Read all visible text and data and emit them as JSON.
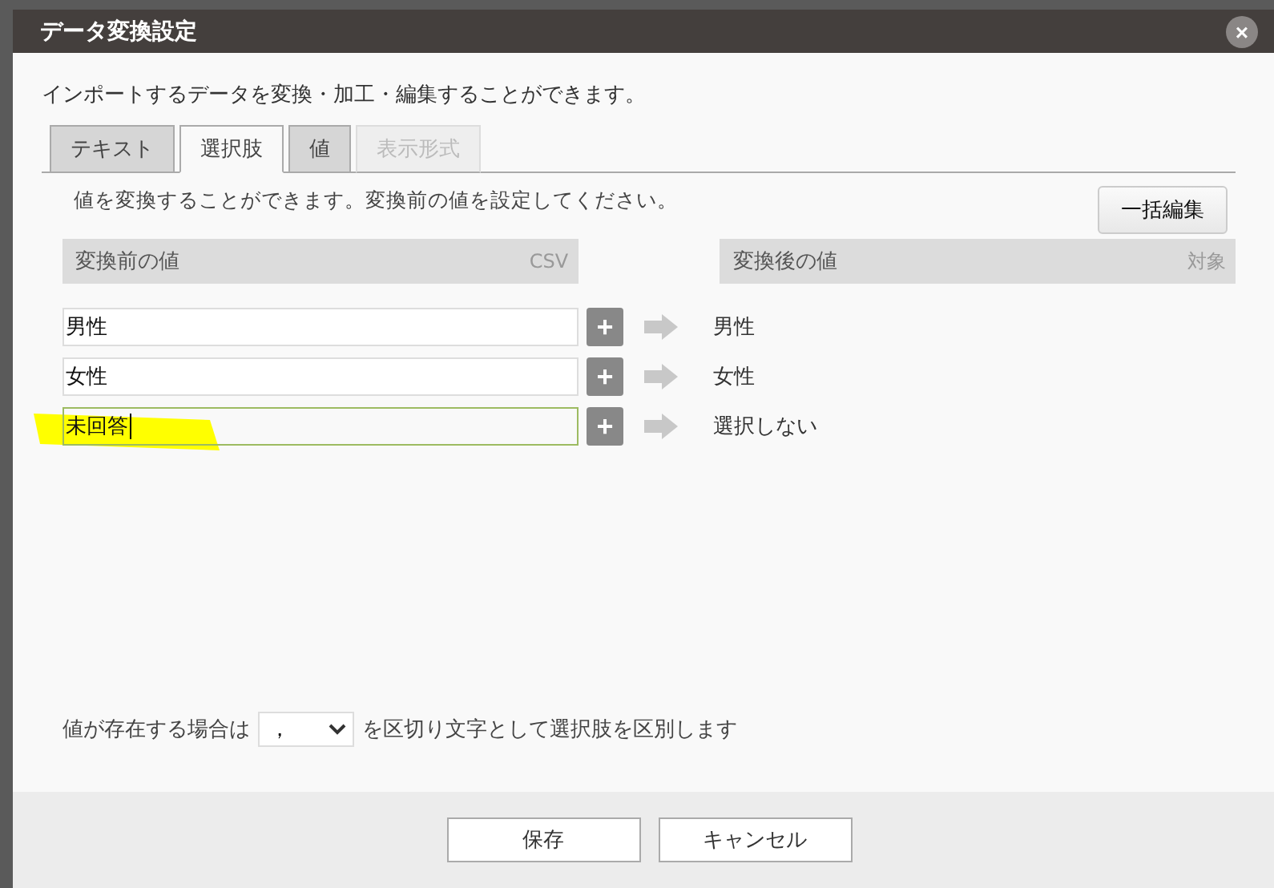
{
  "window": {
    "title": "データ変換設定",
    "close": "×"
  },
  "intro": "インポートするデータを変換・加工・編集することができます。",
  "tabs": [
    {
      "label": "テキスト",
      "selected": false,
      "disabled": false
    },
    {
      "label": "選択肢",
      "selected": true,
      "disabled": false
    },
    {
      "label": "値",
      "selected": false,
      "disabled": false
    },
    {
      "label": "表示形式",
      "selected": false,
      "disabled": true
    }
  ],
  "description": "値を変換することができます。変換前の値を設定してください。",
  "bulk_edit_button": "一括編集",
  "before_header": {
    "label": "変換前の値",
    "tag": "CSV"
  },
  "after_header": {
    "label": "変換後の値",
    "tag": "対象"
  },
  "rows": [
    {
      "value": "男性",
      "result": "男性",
      "focused": false,
      "highlighted": false,
      "add": "+"
    },
    {
      "value": "女性",
      "result": "女性",
      "focused": false,
      "highlighted": false,
      "add": "+"
    },
    {
      "value": "未回答",
      "result": "選択しない",
      "focused": true,
      "highlighted": true,
      "add": "+"
    }
  ],
  "separator": {
    "prefix": "値が存在する場合は",
    "value": "，",
    "suffix": "を区切り文字として選択肢を区別します"
  },
  "buttons": [
    "保存",
    "キャンセル"
  ]
}
